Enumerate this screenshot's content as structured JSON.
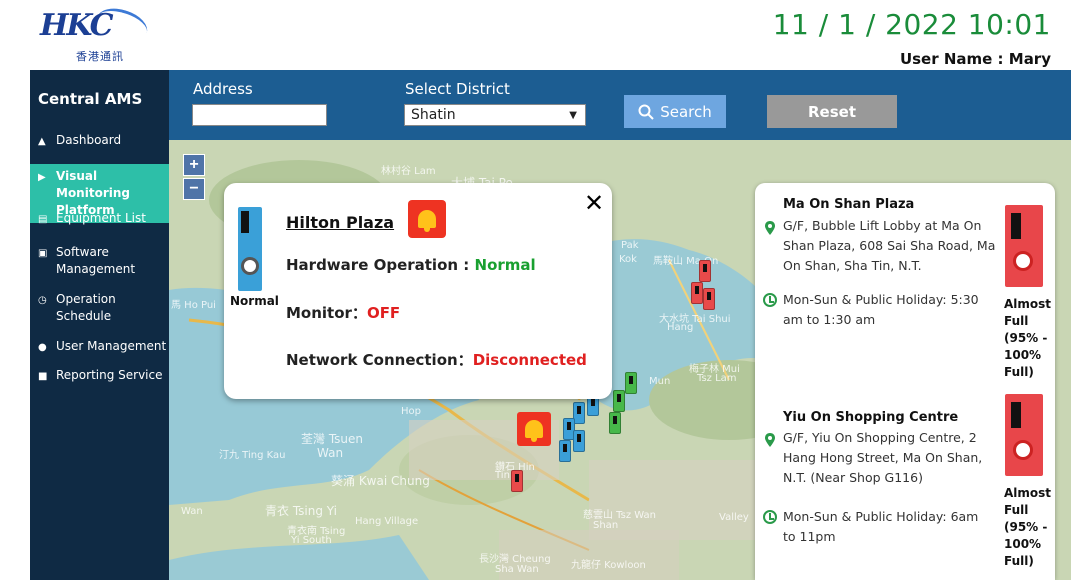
{
  "header": {
    "logo_text": "HKC",
    "logo_subtext": "香港通訊",
    "datetime": "11 / 1 / 2022 10:01",
    "user_label": "User Name : Mary"
  },
  "sidebar": {
    "title": "Central AMS",
    "items": [
      {
        "label": "Dashboard",
        "icon": "home-icon"
      },
      {
        "label": "Visual Monitoring Platform",
        "icon": "monitor-icon",
        "active": true
      },
      {
        "label": "Equipment List",
        "icon": "list-icon"
      },
      {
        "label": "Software Management",
        "icon": "window-icon"
      },
      {
        "label": "Operation Schedule",
        "icon": "clock-icon"
      },
      {
        "label": "User Management",
        "icon": "users-icon"
      },
      {
        "label": "Reporting Service",
        "icon": "document-icon"
      }
    ]
  },
  "filters": {
    "address_label": "Address",
    "address_value": "",
    "district_label": "Select District",
    "district_value": "Shatin",
    "search_label": "Search",
    "reset_label": "Reset"
  },
  "map": {
    "zoom_in": "+",
    "zoom_out": "−",
    "place_labels": [
      "林村谷 Lam",
      "大埔 Tai Po",
      "Pak",
      "Kok",
      "馬鞍山 Ma On",
      "大水坑 Tai Shui",
      "Hang",
      "梅子林 Mui",
      "Tsz Lam",
      "Mun",
      "荃灣 Tsuen",
      "Wan",
      "汀九 Ting Kau",
      "葵涌 Kwai Chung",
      "青衣 Tsing Yi",
      "長沙灣 Cheung",
      "Sha Wan",
      "慈雲山 Tsz Wan",
      "Shan",
      "九龍仔 Kowloon",
      "Hop",
      "Wan",
      "馬 Ho Pui",
      "Hang Village",
      "Valley",
      "鑽石 Hin",
      "Tin",
      "青衣南 Tsing",
      "Yi South"
    ]
  },
  "popup": {
    "title": "Hilton Plaza",
    "device_status": "Normal",
    "hardware_label": "Hardware Operation : ",
    "hardware_value": "Normal",
    "monitor_label": "Monitor：",
    "monitor_value": "OFF",
    "network_label": "Network Connection：",
    "network_value": "Disconnected",
    "close": "✕"
  },
  "locations": [
    {
      "name": "Ma On Shan Plaza",
      "address": "G/F, Bubble Lift Lobby at Ma On Shan Plaza, 608 Sai Sha Road, Ma On Shan, Sha Tin, N.T.",
      "hours": "Mon-Sun & Public Holiday: 5:30 am to 1:30 am",
      "status": "Almost\nFull\n(95% -\n100%\nFull)"
    },
    {
      "name": "Yiu On Shopping Centre",
      "address": "G/F, Yiu On Shopping Centre, 2 Hang Hong Street, Ma On Shan, N.T. (Near Shop G116)",
      "hours": "Mon-Sun & Public Holiday: 6am to 11pm",
      "status": "Almost\nFull\n(95% -\n100%\nFull)"
    }
  ],
  "colors": {
    "sidebar_bg": "#0f2a44",
    "active_item": "#2dbfa8",
    "filterbar_bg": "#1c5d92",
    "datetime": "#1a8c3a",
    "ok_green": "#19a030",
    "alert_red": "#e02020"
  }
}
